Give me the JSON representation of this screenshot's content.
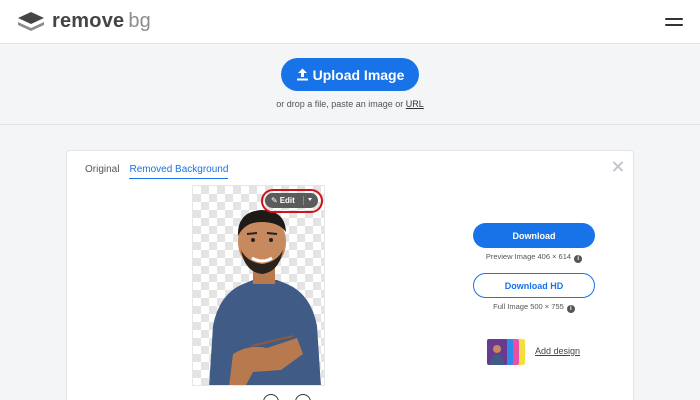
{
  "header": {
    "brand_main": "remove",
    "brand_accent": "bg",
    "logo_icon": "layered-diamond-icon",
    "menu_icon": "hamburger-icon"
  },
  "upload": {
    "button_label": "Upload Image",
    "button_icon": "upload-arrow-icon",
    "hint_prefix": "or drop a file, paste an image or",
    "hint_link": "URL"
  },
  "result": {
    "tabs": [
      {
        "label": "Original",
        "active": false
      },
      {
        "label": "Removed Background",
        "active": true
      }
    ],
    "close_icon": "close-icon",
    "edit": {
      "label": "Edit",
      "icon": "pencil-icon",
      "dropdown_icon": "caret-down-icon"
    },
    "download": {
      "label": "Download",
      "info": "Preview Image 406 × 614"
    },
    "download_hd": {
      "label": "Download HD",
      "info": "Full Image 500 × 755"
    },
    "add_design": {
      "label": "Add design"
    }
  },
  "colors": {
    "accent": "#1973e8",
    "highlight_ring": "#d0121b",
    "page_bg": "#f4f5f7"
  }
}
